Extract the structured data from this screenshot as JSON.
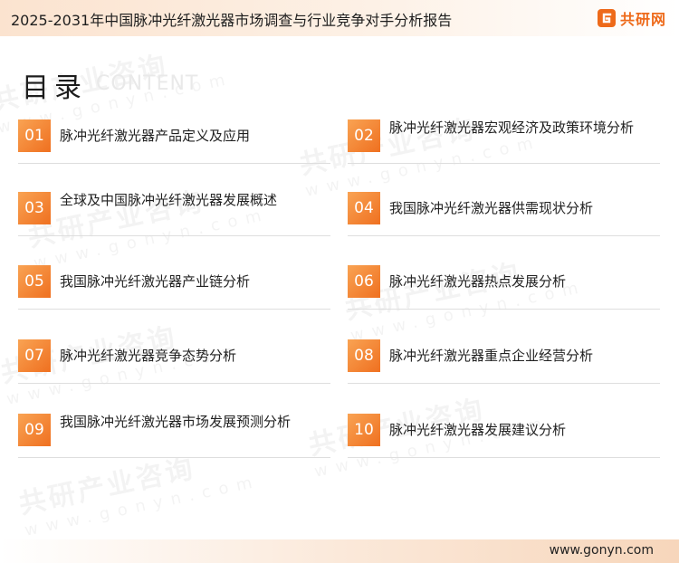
{
  "header": {
    "title": "2025-2031年中国脉冲光纤激光器市场调查与行业竞争对手分析报告",
    "logo_text": "共研网"
  },
  "toc": {
    "title": "目录",
    "subtitle": "CONTENT",
    "items": [
      {
        "num": "01",
        "label": "脉冲光纤激光器产品定义及应用"
      },
      {
        "num": "02",
        "label": "脉冲光纤激光器宏观经济及政策环境分析"
      },
      {
        "num": "03",
        "label": "全球及中国脉冲光纤激光器发展概述"
      },
      {
        "num": "04",
        "label": "我国脉冲光纤激光器供需现状分析"
      },
      {
        "num": "05",
        "label": "我国脉冲光纤激光器产业链分析"
      },
      {
        "num": "06",
        "label": "脉冲光纤激光器热点发展分析"
      },
      {
        "num": "07",
        "label": "脉冲光纤激光器竞争态势分析"
      },
      {
        "num": "08",
        "label": "脉冲光纤激光器重点企业经营分析"
      },
      {
        "num": "09",
        "label": "我国脉冲光纤激光器市场发展预测分析"
      },
      {
        "num": "10",
        "label": "脉冲光纤激光器发展建议分析"
      }
    ]
  },
  "watermark": {
    "text": "共研产业咨询",
    "sub": "www.gonyn.com"
  },
  "footer": {
    "url": "www.gonyn.com"
  },
  "colors": {
    "accent": "#ef7020",
    "accent_light": "#f9a353",
    "header_bg": "#fbe3cf"
  }
}
